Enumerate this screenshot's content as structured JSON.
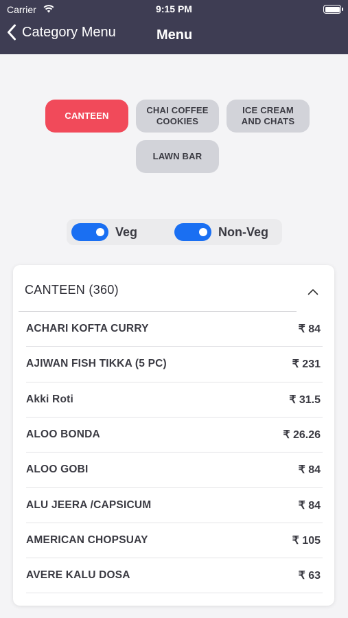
{
  "status": {
    "carrier": "Carrier",
    "time": "9:15 PM"
  },
  "nav": {
    "back_label": "Category Menu",
    "title": "Menu"
  },
  "categories": [
    {
      "label": "CANTEEN",
      "active": true
    },
    {
      "label": "CHAI COFFEE\nCOOKIES",
      "active": false
    },
    {
      "label": "ICE CREAM\nAND CHATS",
      "active": false
    },
    {
      "label": "LAWN BAR",
      "active": false
    }
  ],
  "filters": {
    "veg_label": "Veg",
    "veg_on": true,
    "nonveg_label": "Non-Veg",
    "nonveg_on": true
  },
  "section": {
    "title": "CANTEEN (360)",
    "expanded": true
  },
  "items": [
    {
      "name": "ACHARI KOFTA CURRY",
      "price": "₹ 84"
    },
    {
      "name": "AJIWAN FISH TIKKA (5 PC)",
      "price": "₹ 231"
    },
    {
      "name": "Akki Roti",
      "price": "₹ 31.5"
    },
    {
      "name": "ALOO BONDA",
      "price": "₹ 26.26"
    },
    {
      "name": "ALOO GOBI",
      "price": "₹ 84"
    },
    {
      "name": "ALU JEERA /CAPSICUM",
      "price": "₹ 84"
    },
    {
      "name": "AMERICAN CHOPSUAY",
      "price": "₹ 105"
    },
    {
      "name": "AVERE KALU DOSA",
      "price": "₹ 63"
    }
  ],
  "colors": {
    "header": "#3e3d53",
    "accent": "#f14a5a",
    "toggle": "#1a6ff2"
  }
}
